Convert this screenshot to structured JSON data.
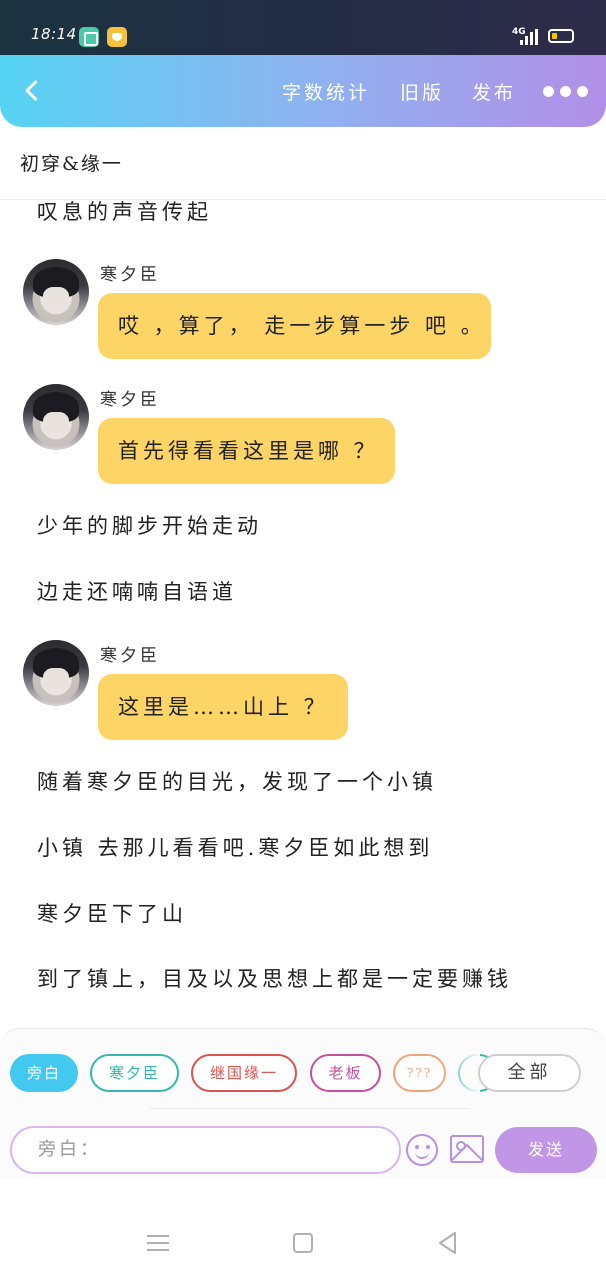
{
  "status_bar": {
    "time": "18:14",
    "network": "4G"
  },
  "header": {
    "word_count": "字数统计",
    "old_version": "旧版",
    "publish": "发布"
  },
  "chat": {
    "title": "初穿&缘一",
    "messages": [
      {
        "type": "narration",
        "text": "叹息的声音传起"
      },
      {
        "type": "dialogue",
        "speaker": "寒夕臣",
        "text": "哎 ，算了， 走一步算一步 吧 。"
      },
      {
        "type": "dialogue",
        "speaker": "寒夕臣",
        "text": "首先得看看这里是哪 ？"
      },
      {
        "type": "narration",
        "text": "少年的脚步开始走动"
      },
      {
        "type": "narration",
        "text": "边走还喃喃自语道"
      },
      {
        "type": "dialogue",
        "speaker": "寒夕臣",
        "text": "这里是……山上 ？"
      },
      {
        "type": "narration",
        "text": "随着寒夕臣的目光，发现了一个小镇"
      },
      {
        "type": "narration",
        "text": "小镇 去那儿看看吧.寒夕臣如此想到"
      },
      {
        "type": "narration",
        "text": "寒夕臣下了山"
      },
      {
        "type": "narration",
        "text": "到了镇上，目及以及思想上都是一定要赚钱"
      }
    ]
  },
  "role_chips": [
    {
      "label": "旁白",
      "color": "#43c9f0",
      "active": true
    },
    {
      "label": "寒夕臣",
      "color": "#34b7b0",
      "active": false
    },
    {
      "label": "继国缘一",
      "color": "#d9534f",
      "active": false
    },
    {
      "label": "老板",
      "color": "#c8509a",
      "active": false
    },
    {
      "label": "???",
      "color": "#f0a27a",
      "active": false
    },
    {
      "label": "",
      "color": "#34b7b0",
      "active": false
    }
  ],
  "all_chip": {
    "label": "全部"
  },
  "composer": {
    "placeholder": "旁白：",
    "send_label": "发送"
  }
}
